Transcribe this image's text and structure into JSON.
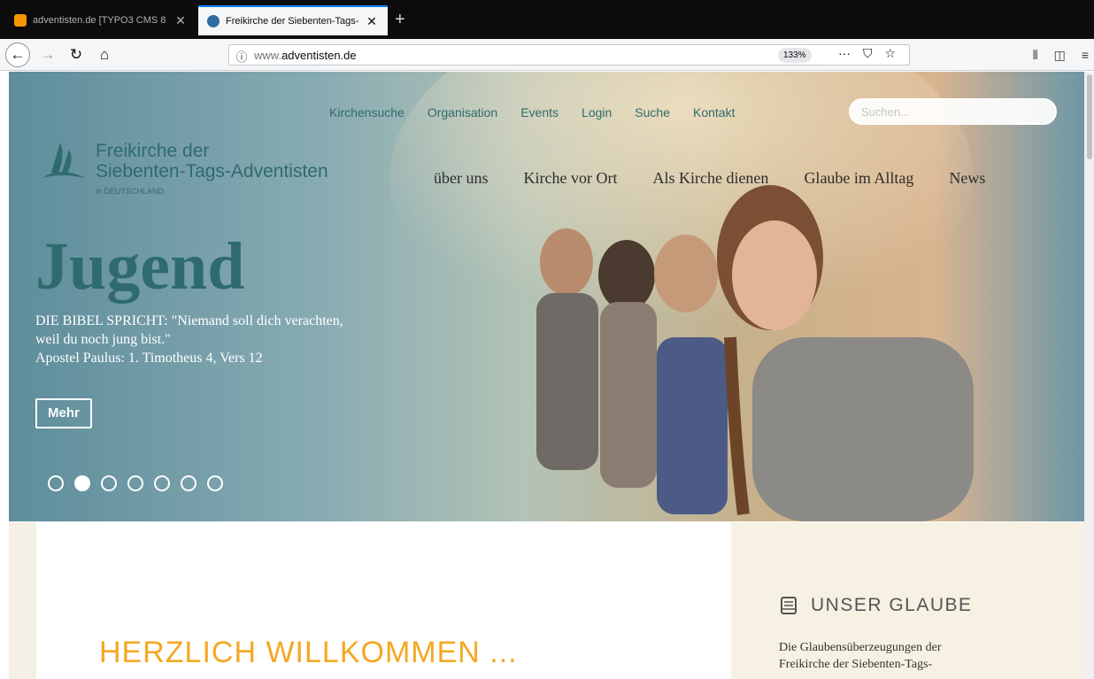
{
  "browser": {
    "tabs": [
      {
        "title": "adventisten.de [TYPO3 CMS 8",
        "close": "✕",
        "favicon_color": "#f49700"
      },
      {
        "title": "Freikirche der Siebenten-Tags-",
        "close": "✕",
        "favicon_color": "#2f6b9e"
      }
    ],
    "new_tab": "+",
    "url_prefix": "www.",
    "url_domain": "adventisten.de",
    "zoom": "133%",
    "page_actions": "···"
  },
  "site": {
    "top_nav": [
      "Kirchensuche",
      "Organisation",
      "Events",
      "Login",
      "Suche",
      "Kontakt"
    ],
    "search_placeholder": "Suchen...",
    "logo": {
      "line1": "Freikirche der",
      "line2": "Siebenten-Tags-Adventisten",
      "line3": "in DEUTSCHLAND"
    },
    "main_nav": [
      "über uns",
      "Kirche vor Ort",
      "Als Kirche dienen",
      "Glaube im Alltag",
      "News"
    ],
    "hero": {
      "heading": "Jugend",
      "quote_line1": "DIE BIBEL SPRICHT: \"Niemand soll dich verachten,",
      "quote_line2": "weil du noch jung bist.\"",
      "quote_line3": "Apostel Paulus: 1. Timotheus 4, Vers 12",
      "button": "Mehr",
      "slide_count": 7,
      "active_slide": 2
    },
    "welcome": "HERZLICH WILLKOMMEN ...",
    "sidebar": {
      "title": "UNSER GLAUBE",
      "text_line1": "Die Glaubensüberzeugungen der",
      "text_line2": "Freikirche der Siebenten-Tags-"
    }
  },
  "colors": {
    "brand_teal": "#2f6b6e",
    "accent_orange": "#f4a823",
    "sidebar_bg": "#f6f1e2"
  }
}
